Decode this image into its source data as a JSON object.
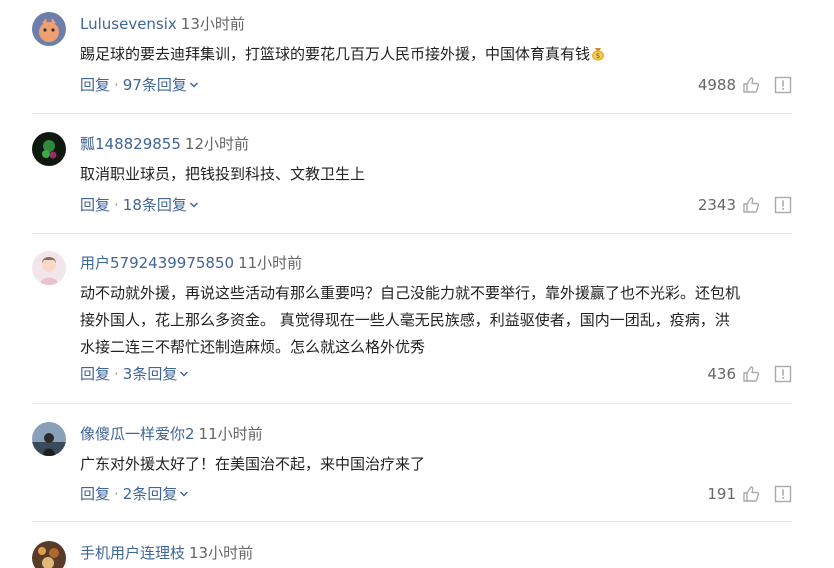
{
  "comments": [
    {
      "username": "Lulusevensix",
      "time": "13小时前",
      "text": "踢足球的要去迪拜集训，打篮球的要花几百万人民币接外援，中国体育真有钱",
      "emoji": "money-bag-emoji",
      "reply_label": "回复",
      "replies_label": "97条回复",
      "likes": "4988"
    },
    {
      "username": "瓢148829855",
      "time": "12小时前",
      "text": "取消职业球员，把钱投到科技、文教卫生上",
      "reply_label": "回复",
      "replies_label": "18条回复",
      "likes": "2343"
    },
    {
      "username": "用户5792439975850",
      "time": "11小时前",
      "text_lines": [
        "动不动就外援，再说这些活动有那么重要吗？自己没能力就不要举行，靠外援赢了也不光彩。还包机",
        "接外国人，花上那么多资金。 真觉得现在一些人毫无民族感，利益驱使者，国内一团乱，疫病，洪",
        "水接二连三不帮忙还制造麻烦。怎么就这么格外优秀"
      ],
      "reply_label": "回复",
      "replies_label": "3条回复",
      "likes": "436"
    },
    {
      "username": "像傻瓜一样爱你2",
      "time": "11小时前",
      "text": "广东对外援太好了！在美国治不起，来中国治疗来了",
      "reply_label": "回复",
      "replies_label": "2条回复",
      "likes": "191"
    },
    {
      "username": "手机用户连理枝",
      "time": "13小时前"
    }
  ],
  "colors": {
    "link": "#406599",
    "text": "#222222",
    "meta": "#666666",
    "divider": "#e8e8e8"
  },
  "icons": {
    "like": "thumbs-up-icon",
    "report": "report-icon",
    "expand": "chevron-down-icon"
  }
}
